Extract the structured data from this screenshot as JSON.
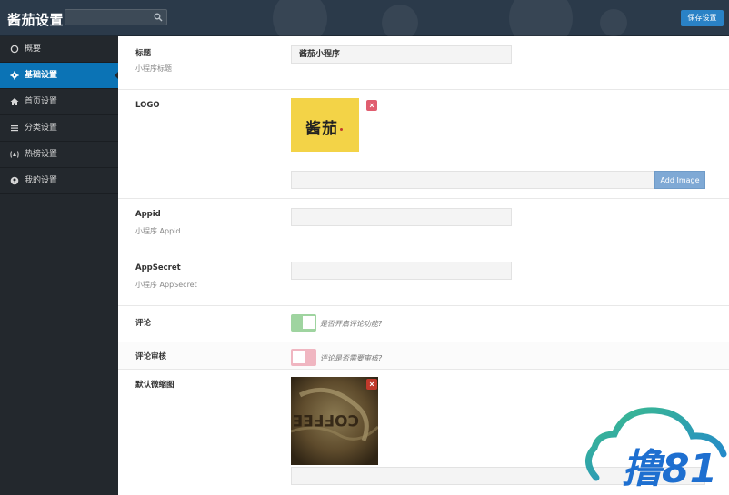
{
  "app": {
    "title": "酱茄设置"
  },
  "header": {
    "save_label": "保存设置",
    "search_value": ""
  },
  "sidebar": {
    "items": [
      {
        "label": "概要",
        "icon": "circle-outline-icon",
        "active": false
      },
      {
        "label": "基础设置",
        "icon": "gear-icon",
        "active": true
      },
      {
        "label": "首页设置",
        "icon": "home-icon",
        "active": false
      },
      {
        "label": "分类设置",
        "icon": "list-icon",
        "active": false
      },
      {
        "label": "热榜设置",
        "icon": "trending-icon",
        "active": false
      },
      {
        "label": "我的设置",
        "icon": "user-circle-icon",
        "active": false
      }
    ]
  },
  "form": {
    "title": {
      "label": "标题",
      "sub": "小程序标题",
      "value": "酱茄小程序"
    },
    "logo": {
      "label": "LOGO",
      "logo_text": "酱茄",
      "url_value": "",
      "add_label": "Add Image"
    },
    "appid": {
      "label": "Appid",
      "sub": "小程序 Appid",
      "value": ""
    },
    "appsecret": {
      "label": "AppSecret",
      "sub": "小程序 AppSecret",
      "value": ""
    },
    "comment": {
      "label": "评论",
      "hint": "是否开启评论功能?"
    },
    "comment_review": {
      "label": "评论审核",
      "hint": "评论是否需要审核?"
    },
    "default_thumb": {
      "label": "默认微缩图",
      "url_value": ""
    }
  },
  "colors": {
    "accent": "#0b73b5",
    "save_button": "#2a82c6",
    "logo_bg": "#f3d347",
    "toggle_on": "#9fd4a0",
    "toggle_off": "#f0b6c1",
    "remove": "#e05d6f",
    "add_image": "#7fa9d5"
  },
  "watermark": {
    "text": "撸81"
  }
}
